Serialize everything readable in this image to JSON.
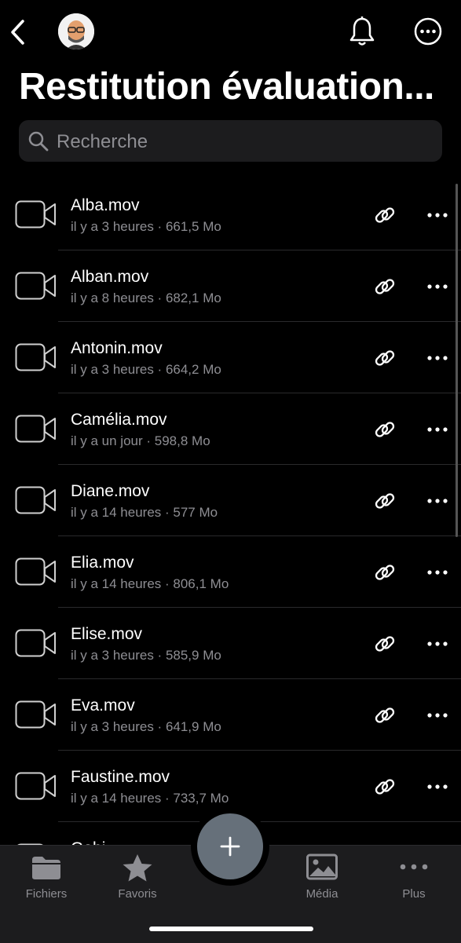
{
  "header": {
    "title": "Restitution évaluation..."
  },
  "search": {
    "placeholder": "Recherche"
  },
  "files": [
    {
      "name": "Alba.mov",
      "meta": "il y a 3 heures · 661,5 Mo"
    },
    {
      "name": "Alban.mov",
      "meta": "il y a 8 heures · 682,1 Mo"
    },
    {
      "name": "Antonin.mov",
      "meta": "il y a 3 heures · 664,2 Mo"
    },
    {
      "name": "Camélia.mov",
      "meta": "il y a un jour · 598,8 Mo"
    },
    {
      "name": "Diane.mov",
      "meta": "il y a 14 heures · 577 Mo"
    },
    {
      "name": "Elia.mov",
      "meta": "il y a 14 heures · 806,1 Mo"
    },
    {
      "name": "Elise.mov",
      "meta": "il y a 3 heures · 585,9 Mo"
    },
    {
      "name": "Eva.mov",
      "meta": "il y a 3 heures · 641,9 Mo"
    },
    {
      "name": "Faustine.mov",
      "meta": "il y a 14 heures · 733,7 Mo"
    },
    {
      "name": "Gabi...",
      "meta": ""
    }
  ],
  "tabs": {
    "files": "Fichiers",
    "favorites": "Favoris",
    "media": "Média",
    "more": "Plus"
  },
  "colors": {
    "background": "#000000",
    "tabbar": "#1c1c1e",
    "fab": "#66707a",
    "secondary_text": "#8e8e93"
  }
}
